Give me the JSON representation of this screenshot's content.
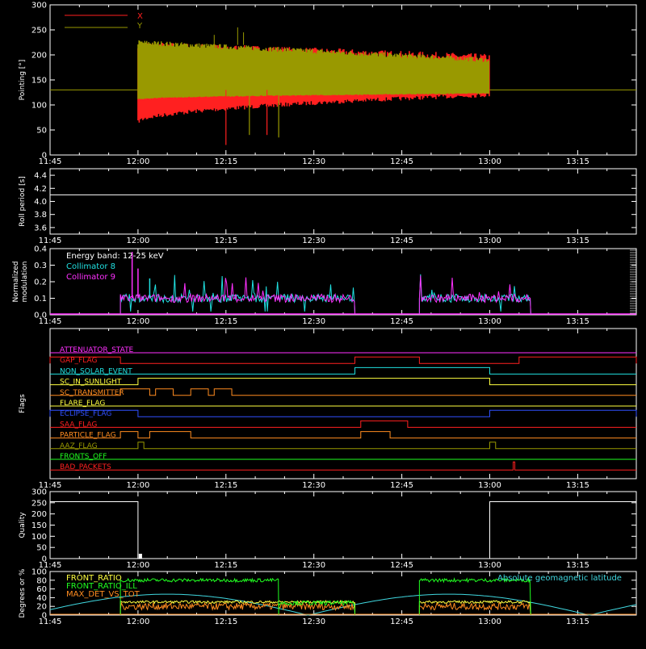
{
  "time_ticks": [
    "11:45",
    "12:00",
    "12:15",
    "12:30",
    "12:45",
    "13:00",
    "13:15"
  ],
  "colors": {
    "background": "#000000",
    "axis": "#ffffff",
    "x_series": "#ff2020",
    "y_series": "#999900",
    "collimator8": "#20e0e0",
    "collimator9": "#ff30ff",
    "cyan": "#40d8e0",
    "green": "#20ff20",
    "yellow": "#ffff40",
    "orange": "#ff8c20",
    "blue": "#3050ff"
  },
  "chart_data": [
    {
      "id": "pointing",
      "type": "line",
      "ylabel": "Pointing [°]",
      "ylim": [
        0,
        300
      ],
      "yticks": [
        "0",
        "50",
        "100",
        "150",
        "200",
        "250",
        "300"
      ],
      "xlim": [
        "11:45",
        "13:25"
      ],
      "legend": "top-left",
      "series": [
        {
          "name": "X",
          "start": "12:00",
          "end": "13:00",
          "band_start": [
            65,
            220
          ],
          "band_end": [
            120,
            195
          ]
        },
        {
          "name": "Y",
          "start": "12:00",
          "end": "13:00",
          "band_start": [
            110,
            225
          ],
          "band_end": [
            122,
            190
          ]
        }
      ],
      "baseline": 130,
      "spikes": [
        {
          "x": "12:15",
          "y": 20
        },
        {
          "x": "12:19",
          "y": 40
        },
        {
          "x": "12:22",
          "y": 40
        },
        {
          "x": "12:24",
          "y": 35
        }
      ]
    },
    {
      "id": "roll_period",
      "type": "line",
      "ylabel": "Roll period [s]",
      "ylim": [
        3.5,
        4.5
      ],
      "yticks": [
        "3.6",
        "3.8",
        "4.0",
        "4.2",
        "4.4"
      ],
      "xlim": [
        "11:45",
        "13:25"
      ],
      "series": [
        {
          "values": [
            4.1
          ]
        }
      ]
    },
    {
      "id": "modulation",
      "type": "line",
      "ylabel": "Normalized modulation",
      "ylabel_lines": [
        "Normalized",
        "modulation"
      ],
      "ylim": [
        0,
        0.4
      ],
      "yticks": [
        "0.0",
        "0.1",
        "0.2",
        "0.3",
        "0.4"
      ],
      "xlim": [
        "11:45",
        "13:25"
      ],
      "legend": "top-left",
      "annotation": "Energy band: 12-25 keV",
      "series": [
        {
          "name": "Collimator 8",
          "segments": [
            [
              "11:57",
              "12:37"
            ],
            [
              "12:48",
              "13:07"
            ]
          ],
          "level": 0.1
        },
        {
          "name": "Collimator 9",
          "segments": [
            [
              "11:57",
              "12:37"
            ],
            [
              "12:48",
              "13:07"
            ]
          ],
          "level": 0.1
        }
      ]
    },
    {
      "id": "flags",
      "type": "line",
      "ylabel": "Flags",
      "xlim": [
        "11:45",
        "13:25"
      ],
      "flags": [
        {
          "name": "ATTENUATOR_STATE",
          "color": "#ff30ff",
          "highs": []
        },
        {
          "name": "GAP_FLAG",
          "color": "#ff2020",
          "highs": [
            [
              "11:45",
              "11:57"
            ],
            [
              "12:37",
              "12:48"
            ],
            [
              "13:05",
              "13:25"
            ]
          ]
        },
        {
          "name": "NON_SOLAR_EVENT",
          "color": "#20e0e0",
          "highs": [
            [
              "12:37",
              "13:00"
            ]
          ]
        },
        {
          "name": "SC_IN_SUNLIGHT",
          "color": "#ffff40",
          "highs": [
            [
              "12:00",
              "13:00"
            ]
          ]
        },
        {
          "name": "SC_TRANSMITTER",
          "color": "#ff8c20",
          "highs": [
            [
              "11:57",
              "12:02"
            ],
            [
              "12:03",
              "12:06"
            ],
            [
              "12:09",
              "12:12"
            ],
            [
              "12:13",
              "12:16"
            ]
          ]
        },
        {
          "name": "FLARE_FLAG",
          "color": "#ffff40",
          "highs": []
        },
        {
          "name": "ECLIPSE_FLAG",
          "color": "#3050ff",
          "highs": [
            [
              "11:45",
              "12:00"
            ],
            [
              "13:00",
              "13:25"
            ]
          ]
        },
        {
          "name": "SAA_FLAG",
          "color": "#ff2020",
          "highs": [
            [
              "12:38",
              "12:46"
            ]
          ]
        },
        {
          "name": "PARTICLE_FLAG",
          "color": "#ff8c20",
          "highs": [
            [
              "11:57",
              "12:00"
            ],
            [
              "12:02",
              "12:09"
            ],
            [
              "12:38",
              "12:43"
            ]
          ]
        },
        {
          "name": "AAZ_FLAG",
          "color": "#999900",
          "highs": [
            [
              "12:00",
              "12:01"
            ],
            [
              "13:00",
              "13:01"
            ]
          ]
        },
        {
          "name": "FRONTS_OFF",
          "color": "#20ff20",
          "highs": []
        },
        {
          "name": "BAD_PACKETS",
          "color": "#ff2020",
          "highs": [
            [
              "13:04",
              "13:04"
            ]
          ]
        }
      ]
    },
    {
      "id": "quality",
      "type": "line",
      "ylabel": "Quality",
      "ylim": [
        0,
        300
      ],
      "yticks": [
        "0",
        "50",
        "100",
        "150",
        "200",
        "250",
        "300"
      ],
      "xlim": [
        "11:45",
        "13:25"
      ],
      "series": [
        {
          "segments": [
            {
              "start": "11:45",
              "end": "12:00",
              "value": 255
            },
            {
              "start": "12:00",
              "end": "13:00",
              "value": 0
            },
            {
              "start": "13:00",
              "end": "13:25",
              "value": 255
            }
          ]
        }
      ]
    },
    {
      "id": "ratios",
      "type": "line",
      "ylabel": "Degrees or %",
      "ylim": [
        0,
        100
      ],
      "yticks": [
        "0",
        "20",
        "40",
        "60",
        "80",
        "100"
      ],
      "xlim": [
        "11:45",
        "13:25"
      ],
      "legend": "top-left",
      "series": [
        {
          "name": "FRONT_RATIO",
          "color": "#ffff40",
          "segments": [
            [
              "11:57",
              "12:37"
            ],
            [
              "12:48",
              "13:07"
            ]
          ],
          "level": 30
        },
        {
          "name": "FRONT_RATIO_ILL",
          "label": "FRONT_RATIO_ILL",
          "color": "#20ff20",
          "segments": [
            [
              "11:57",
              "12:24"
            ],
            [
              "12:48",
              "13:07"
            ]
          ],
          "level": 80,
          "low_level": 28,
          "low_segment": [
            "12:24",
            "12:37"
          ]
        },
        {
          "name": "MAX_DET_VS_TOT",
          "color": "#ff8c20",
          "segments": [
            [
              "11:57",
              "12:37"
            ],
            [
              "12:48",
              "13:07"
            ]
          ],
          "level": 20
        },
        {
          "name": "Absolute geomagnetic latitude",
          "color": "#40d8e0",
          "x_start": "11:45",
          "x_end": "13:25",
          "amplitude": 48,
          "period_min": 48,
          "phase_min": "12:05"
        }
      ]
    }
  ]
}
